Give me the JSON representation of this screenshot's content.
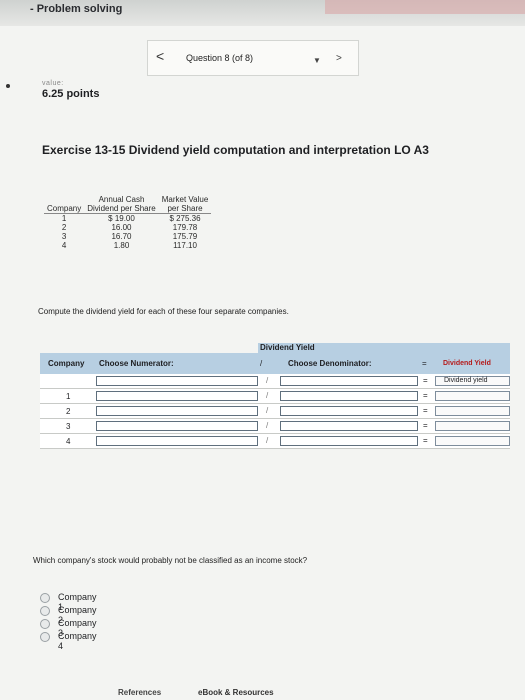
{
  "header": {
    "title": "- Problem solving"
  },
  "nav": {
    "prev_symbol": "<",
    "label": "Question 8 (of 8)",
    "dropdown_symbol": "▼",
    "next_symbol": ">"
  },
  "score": {
    "value_label": "value:",
    "points": "6.25 points"
  },
  "exercise": {
    "title": "Exercise 13-15 Dividend yield computation and interpretation LO A3"
  },
  "data_table": {
    "headers": {
      "company": "Company",
      "annual_line1": "Annual Cash",
      "annual_line2": "Dividend per Share",
      "market_line1": "Market Value",
      "market_line2": "per Share"
    },
    "rows": [
      {
        "company": "1",
        "dividend": "$ 19.00",
        "market": "$ 275.36"
      },
      {
        "company": "2",
        "dividend": "16.00",
        "market": "179.78"
      },
      {
        "company": "3",
        "dividend": "16.70",
        "market": "175.79"
      },
      {
        "company": "4",
        "dividend": "1.80",
        "market": "117.10"
      }
    ]
  },
  "prompt": "Compute the dividend yield for each of these four separate companies.",
  "calc_table": {
    "group_header": "Dividend Yield",
    "headers": {
      "company": "Company",
      "numerator": "Choose Numerator:",
      "slash": "/",
      "denominator": "Choose Denominator:",
      "equals": "=",
      "result": "Dividend Yield"
    },
    "label_row": {
      "slash": "/",
      "equals": "=",
      "result": "Dividend yield"
    },
    "rows": [
      {
        "company": "1",
        "slash": "/",
        "equals": "="
      },
      {
        "company": "2",
        "slash": "/",
        "equals": "="
      },
      {
        "company": "3",
        "slash": "/",
        "equals": "="
      },
      {
        "company": "4",
        "slash": "/",
        "equals": "="
      }
    ]
  },
  "question": "Which company's stock would probably not be classified as an income stock?",
  "options": [
    "Company 1",
    "Company 2",
    "Company 3",
    "Company 4"
  ],
  "footer": {
    "references": "References",
    "ebook": "eBook & Resources"
  }
}
